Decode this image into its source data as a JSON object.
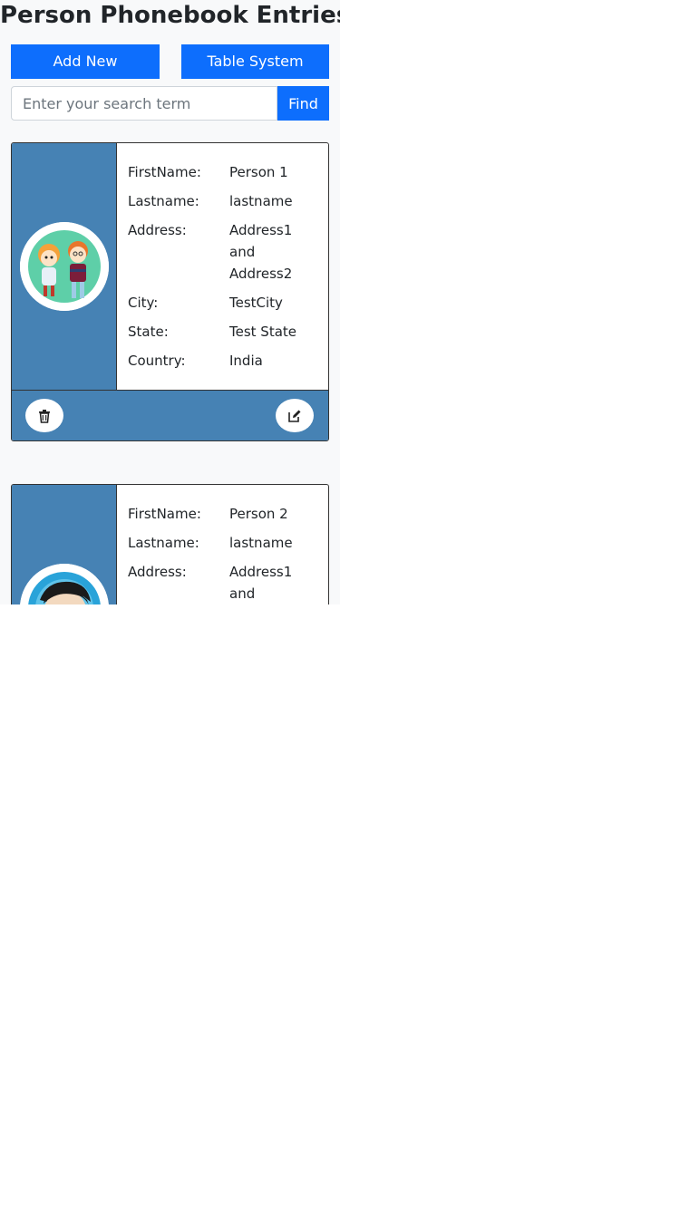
{
  "header": {
    "title": "Person Phonebook Entries"
  },
  "actions": {
    "add_new": "Add New",
    "table_system": "Table System"
  },
  "search": {
    "placeholder": "Enter your search term",
    "button": "Find"
  },
  "labels": {
    "firstname": "FirstName:",
    "lastname": "Lastname:",
    "address": "Address:",
    "city": "City:",
    "state": "State:",
    "country": "Country:"
  },
  "entries": [
    {
      "firstname": "Person 1",
      "lastname": "lastname",
      "address": "Address1 and Address2",
      "city": "TestCity",
      "state": "Test State",
      "country": "India",
      "avatar_icon": "cartoon-kids-avatar"
    },
    {
      "firstname": "Person 2",
      "lastname": "lastname",
      "address": "Address1 and",
      "avatar_icon": "cartoon-man-avatar"
    }
  ],
  "icons": {
    "delete": "trash-icon",
    "edit": "edit-icon"
  },
  "colors": {
    "primary": "#0d6efd",
    "card_accent": "#4682b4",
    "panel_bg": "#f8f9fa"
  }
}
